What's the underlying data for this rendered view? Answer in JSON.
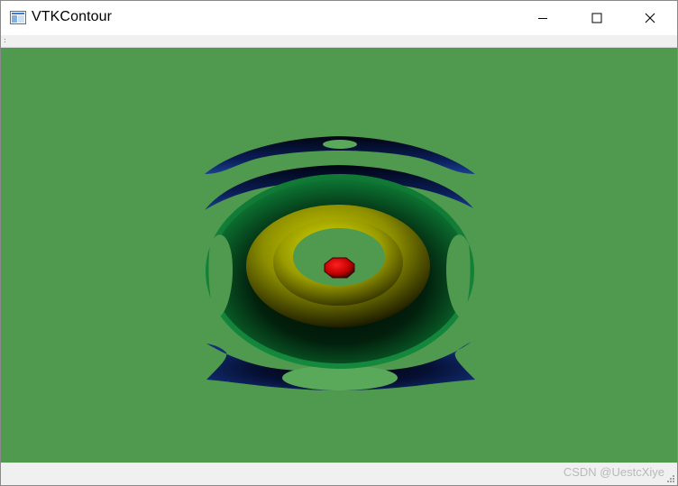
{
  "window": {
    "title": "VTKContour",
    "icon": "vtk-window-icon",
    "controls": {
      "minimize": "minimize-icon",
      "maximize": "maximize-icon",
      "close": "close-icon"
    }
  },
  "viewport": {
    "background_color": "#4f9a4e",
    "scene": "contour-surfaces",
    "colors": {
      "outer_shell": "#0a1f5c",
      "middle_shell": "#0a6a2e",
      "inner_shell": "#b5b800",
      "core": "#e00000"
    }
  },
  "statusbar": {
    "watermark": "CSDN @UestcXiye"
  }
}
